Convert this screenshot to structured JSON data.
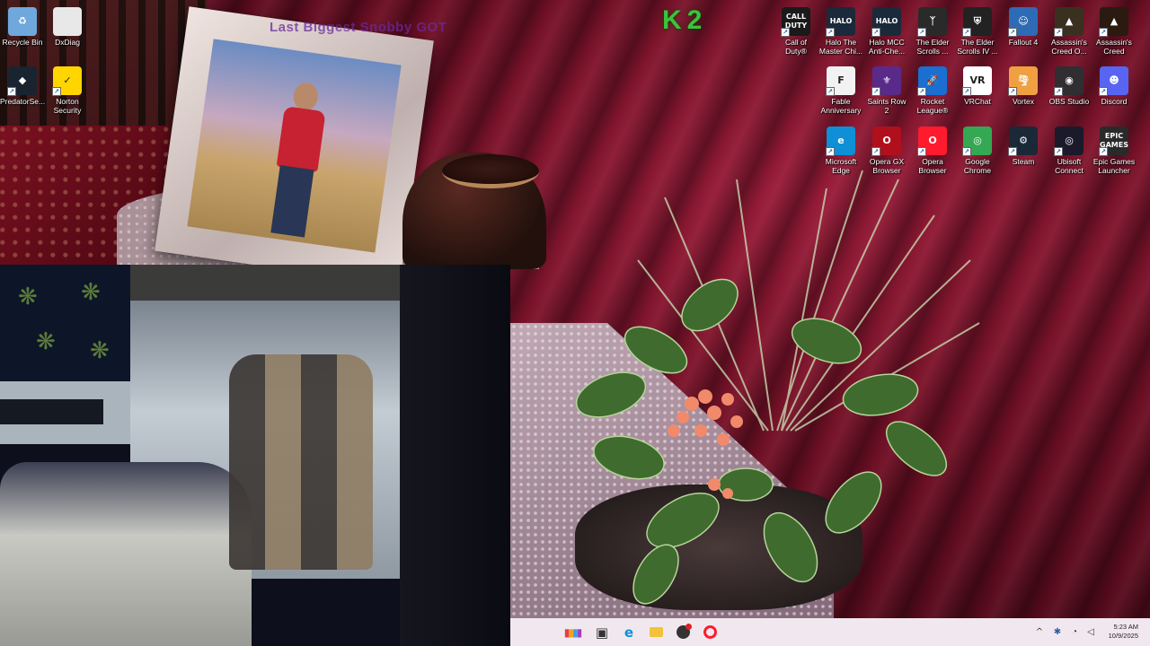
{
  "overlay": {
    "watermark_text": "Last Biggest Snobby GOT",
    "logo_text": "K2"
  },
  "desktop_icons": [
    {
      "name": "recycle-bin",
      "label": "Recycle Bin",
      "icon": "recycle-bin-icon",
      "color": "#6fa8dc"
    },
    {
      "name": "dxdiag",
      "label": "DxDiag",
      "icon": "document-icon",
      "color": "#e8e8e8"
    },
    {
      "name": "predator-sense",
      "label": "PredatorSe...",
      "icon": "predator-icon",
      "color": "#1a2430"
    },
    {
      "name": "norton",
      "label": "Norton Security Ultra",
      "icon": "norton-icon",
      "color": "#ffd500"
    },
    {
      "name": "call-of-duty",
      "label": "Call of Duty®",
      "icon": "cod-icon",
      "color": "#1a1a1a"
    },
    {
      "name": "halo-master-chief",
      "label": "Halo The Master Chi...",
      "icon": "halo-icon",
      "color": "#1a2a3a"
    },
    {
      "name": "halo-mcc",
      "label": "Halo MCC Anti-Che...",
      "icon": "halo-icon",
      "color": "#1a2a3a"
    },
    {
      "name": "elder-scrolls-v",
      "label": "The Elder Scrolls ...",
      "icon": "elder-scrolls-icon",
      "color": "#2a2a2a"
    },
    {
      "name": "elder-scrolls-iv",
      "label": "The Elder Scrolls IV ...",
      "icon": "elder-scrolls-icon",
      "color": "#222222"
    },
    {
      "name": "fallout-4",
      "label": "Fallout 4",
      "icon": "vault-boy-icon",
      "color": "#2e6bb5"
    },
    {
      "name": "assassins-creed-o",
      "label": "Assassin's Creed O...",
      "icon": "assassins-creed-icon",
      "color": "#3a3020"
    },
    {
      "name": "assassins-creed-mirage",
      "label": "Assassin's Creed Mirage",
      "icon": "assassins-creed-icon",
      "color": "#2a1a10"
    },
    {
      "name": "fable",
      "label": "Fable Anniversary",
      "icon": "fable-icon",
      "color": "#f2f2f2"
    },
    {
      "name": "saints-row-2",
      "label": "Saints Row 2",
      "icon": "fleur-de-lis-icon",
      "color": "#5a2a8a"
    },
    {
      "name": "rocket-league",
      "label": "Rocket League®",
      "icon": "rocket-league-icon",
      "color": "#1a6fd0"
    },
    {
      "name": "vrchat",
      "label": "VRChat",
      "icon": "vrchat-icon",
      "color": "#ffffff"
    },
    {
      "name": "vortex",
      "label": "Vortex",
      "icon": "vortex-icon",
      "color": "#f0a040"
    },
    {
      "name": "obs-studio",
      "label": "OBS Studio",
      "icon": "obs-icon",
      "color": "#302e31"
    },
    {
      "name": "discord",
      "label": "Discord",
      "icon": "discord-icon",
      "color": "#5865f2"
    },
    {
      "name": "microsoft-edge",
      "label": "Microsoft Edge",
      "icon": "edge-icon",
      "color": "#0f8fd6"
    },
    {
      "name": "opera-gx",
      "label": "Opera GX Browser",
      "icon": "opera-gx-icon",
      "color": "#b0101c"
    },
    {
      "name": "opera",
      "label": "Opera Browser",
      "icon": "opera-icon",
      "color": "#ff1b2d"
    },
    {
      "name": "google-chrome",
      "label": "Google Chrome",
      "icon": "chrome-icon",
      "color": "#34a853"
    },
    {
      "name": "steam",
      "label": "Steam",
      "icon": "steam-icon",
      "color": "#1b2838"
    },
    {
      "name": "ubisoft-connect",
      "label": "Ubisoft Connect",
      "icon": "ubisoft-icon",
      "color": "#1a1a2a"
    },
    {
      "name": "epic-games",
      "label": "Epic Games Launcher",
      "icon": "epic-games-icon",
      "color": "#2a2a2a"
    }
  ],
  "icon_glyphs": {
    "recycle-bin": "♻",
    "dxdiag": "",
    "predator-sense": "◆",
    "norton": "✓",
    "call-of-duty": "CALL\nDUTY",
    "halo-master-chief": "HALO",
    "halo-mcc": "HALO",
    "elder-scrolls-v": "ᛉ",
    "elder-scrolls-iv": "⛨",
    "fallout-4": "☺",
    "assassins-creed-o": "▲",
    "assassins-creed-mirage": "▲",
    "fable": "F",
    "saints-row-2": "⚜",
    "rocket-league": "🚀",
    "vrchat": "VR",
    "vortex": "🌪",
    "obs-studio": "◉",
    "discord": "☻",
    "microsoft-edge": "e",
    "opera-gx": "O",
    "opera": "O",
    "google-chrome": "◎",
    "steam": "⚙",
    "ubisoft-connect": "◎",
    "epic-games": "EPIC\nGAMES"
  },
  "taskbar": {
    "apps": [
      {
        "name": "color-app",
        "icon": "paint-icon",
        "glyph": "▮▮▮▮"
      },
      {
        "name": "task-view",
        "icon": "task-view-icon",
        "glyph": "▣"
      },
      {
        "name": "edge",
        "icon": "edge-icon",
        "glyph": "e"
      },
      {
        "name": "file-explorer",
        "icon": "folder-icon",
        "glyph": "📁"
      },
      {
        "name": "media-app",
        "icon": "media-icon",
        "glyph": "●"
      },
      {
        "name": "opera",
        "icon": "opera-icon",
        "glyph": "O"
      }
    ],
    "tray": {
      "chevron": "^",
      "time": "5:23 AM",
      "date": "10/9/2025"
    }
  }
}
